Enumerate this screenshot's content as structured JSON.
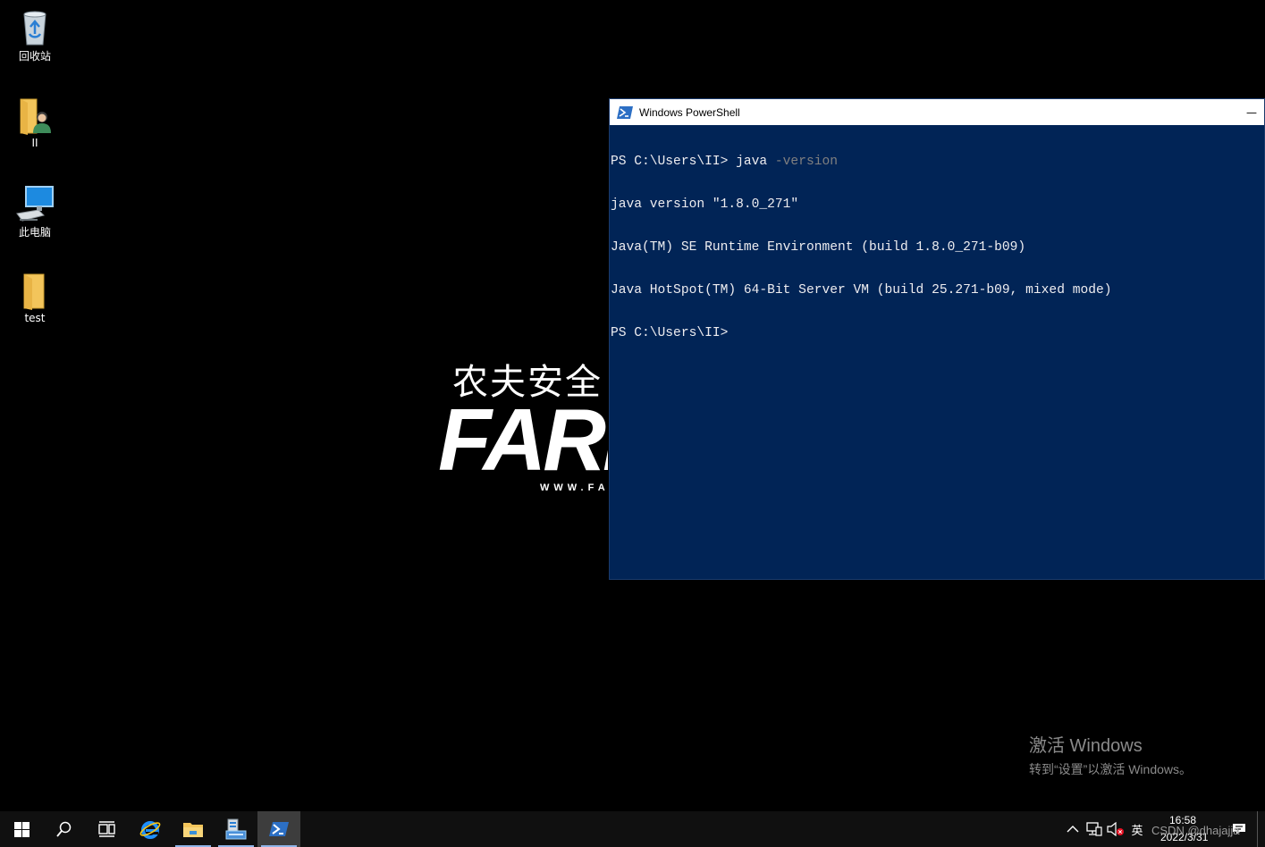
{
  "desktop": {
    "icons": [
      {
        "label": "回收站",
        "icon": "recycle-bin-icon"
      },
      {
        "label": "II",
        "icon": "user-folder-icon"
      },
      {
        "label": "此电脑",
        "icon": "computer-icon"
      },
      {
        "label": "test",
        "icon": "folder-icon"
      }
    ],
    "wallpaper": {
      "cn": "农夫安全",
      "en": "FARM",
      "url": "WWW.FA"
    }
  },
  "powershell": {
    "title": "Windows PowerShell",
    "minimize": "—",
    "lines": [
      {
        "prompt": "PS C:\\Users\\II> ",
        "cmd": "java ",
        "param": "-version"
      },
      {
        "text": "java version \"1.8.0_271\""
      },
      {
        "text": "Java(TM) SE Runtime Environment (build 1.8.0_271-b09)"
      },
      {
        "text": "Java HotSpot(TM) 64-Bit Server VM (build 25.271-b09, mixed mode)"
      },
      {
        "prompt": "PS C:\\Users\\II> "
      }
    ]
  },
  "activation": {
    "title": "激活 Windows",
    "subtitle": "转到“设置”以激活 Windows。"
  },
  "taskbar": {
    "apps": [
      "start-icon",
      "search-icon",
      "task-view-icon",
      "internet-explorer-icon",
      "file-explorer-icon",
      "server-manager-icon",
      "powershell-icon"
    ],
    "tray": {
      "ime": "英",
      "time": "16:58",
      "date": "2022/3/31"
    },
    "watermark": "CSDN @dhajajja"
  },
  "colors": {
    "ps_background": "#012456",
    "ps_text": "#eeedf0",
    "ps_param": "#808080",
    "taskbar": "#101010"
  }
}
